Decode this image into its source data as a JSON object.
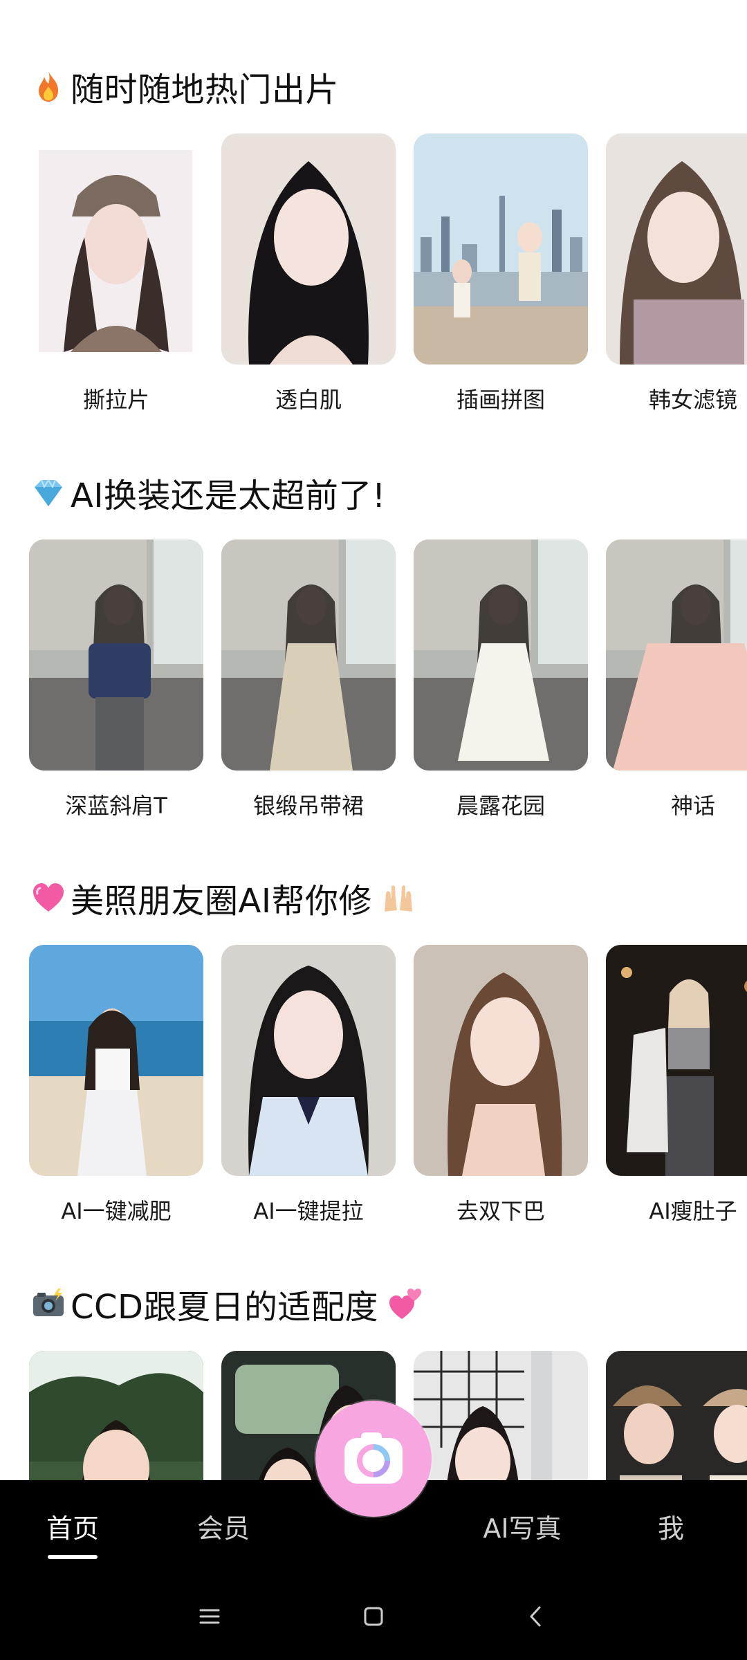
{
  "sections": [
    {
      "title": "随时随地热门出片",
      "icon": "fire-icon",
      "items": [
        {
          "label": "撕拉片"
        },
        {
          "label": "透白肌"
        },
        {
          "label": "插画拼图"
        },
        {
          "label": "韩女滤镜"
        }
      ]
    },
    {
      "title": "AI换装还是太超前了!",
      "icon": "diamond-icon",
      "items": [
        {
          "label": "深蓝斜肩T"
        },
        {
          "label": "银缎吊带裙"
        },
        {
          "label": "晨露花园"
        },
        {
          "label": "神话"
        }
      ]
    },
    {
      "title": "美照朋友圈AI帮你修",
      "icon": "heart-icon",
      "trailing_icon": "raised-hands-icon",
      "items": [
        {
          "label": "AI一键减肥"
        },
        {
          "label": "AI一键提拉"
        },
        {
          "label": "去双下巴"
        },
        {
          "label": "AI瘦肚子"
        }
      ]
    },
    {
      "title": "CCD跟夏日的适配度",
      "icon": "camera-flash-icon",
      "trailing_icon": "two-hearts-icon",
      "items": [
        {
          "label": ""
        },
        {
          "label": ""
        },
        {
          "label": ""
        },
        {
          "label": ""
        }
      ]
    }
  ],
  "bottom_nav": {
    "items": [
      {
        "label": "首页",
        "active": true
      },
      {
        "label": "会员",
        "active": false
      },
      {
        "label": "AI写真",
        "active": false
      },
      {
        "label": "我",
        "active": false
      }
    ],
    "camera_button": "camera-icon",
    "accent": "#f7a6e0"
  },
  "system_nav": {
    "buttons": [
      "menu-icon",
      "home-icon",
      "back-icon"
    ]
  }
}
